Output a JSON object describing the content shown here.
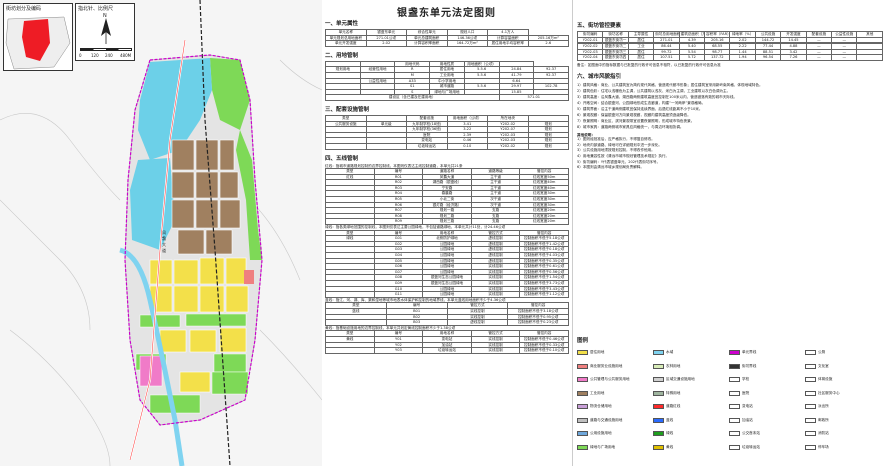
{
  "title": "银盏东单元法定图则",
  "inset": {
    "title": "街坊划分及编码",
    "north_title": "指北针、比例尺",
    "north": "N",
    "scale": [
      "0",
      "120",
      "240",
      "480M"
    ]
  },
  "s1": {
    "title": "一、单元属性",
    "rows": [
      [
        "单元名称",
        "银盏东单元",
        "综合性单元",
        "规划人口",
        "4.1万人"
      ],
      [
        "单元规划总用地面积",
        "271.01公顷",
        "单元总建筑面积",
        "146.36公顷",
        "计算容量面积",
        "205.16万m²"
      ],
      [
        "单元开发强度",
        "2.02",
        "计算容积率面积",
        "164.72万m²",
        "居住用地平均容积率",
        "2.6"
      ]
    ]
  },
  "s2": {
    "title": "二、用地管制",
    "head": [
      "",
      "",
      "用地代码",
      "用地性质",
      "用地面积（公顷）",
      ""
    ],
    "rows": [
      [
        "规划用地",
        "经营性用地",
        "R",
        "居住用地",
        "5.5.6",
        "24.84",
        "92.37"
      ],
      [
        "",
        "",
        "M",
        "工业用地",
        "5.5.6",
        "41.79",
        "92.37"
      ],
      [
        "",
        "公益性用地",
        "A33",
        "中小学用地",
        "",
        "6.64",
        ""
      ],
      [
        "",
        "",
        "S1",
        "城市道路",
        "5.5.6",
        "29.97",
        "102.78"
      ],
      [
        "",
        "",
        "S",
        "绿地与广场用地",
        "",
        "15.85",
        ""
      ]
    ],
    "total": [
      "建设区（含已建及在建用地）",
      "",
      "",
      "",
      "",
      "",
      "",
      "",
      "",
      "571.01"
    ]
  },
  "s3": {
    "title": "三、配套设施管制",
    "head": [
      "类型",
      "",
      "配套设施",
      "用地面积（公顷）",
      "所在地块",
      ""
    ],
    "rows": [
      [
        "公共服务设施",
        "单元级",
        "九年制学校(18班)",
        "3.41",
        "Y202-02",
        "规划"
      ],
      [
        "",
        "",
        "九年制学校(36班)",
        "3.22",
        "Y202-07",
        "规划"
      ],
      [
        "",
        "",
        "医院",
        "2.39",
        "Y202-03",
        "规划"
      ],
      [
        "",
        "",
        "变电站",
        "0.46",
        "Y202-03",
        "规划"
      ],
      [
        "",
        "",
        "垃圾转运站",
        "0.10",
        "Y202-02",
        "规划"
      ]
    ]
  },
  "s4": {
    "title": "四、五线管制",
    "red_note": "红线：指城市道路规划控制的边界控制线，本图则仅表达主线控制道路，本单元共21条",
    "red_head": [
      "类型",
      "编号",
      "道路名称",
      "道路等级",
      "管控内容"
    ],
    "red_rows": [
      [
        "红线",
        "R01",
        "凤翥大道",
        "主干道",
        "红线宽度50m"
      ],
      [
        "",
        "R02",
        "湖西路（银盏段）",
        "主干道",
        "红线宽度40m"
      ],
      [
        "",
        "R03",
        "宁安路",
        "主干道",
        "红线宽度40m"
      ],
      [
        "",
        "R04",
        "春晨路",
        "主干道",
        "红线宽度30m"
      ],
      [
        "",
        "R05",
        "小北二街",
        "次干道",
        "红线宽度30m"
      ],
      [
        "",
        "R06",
        "银灯路（经济路）",
        "次干道",
        "红线宽度30m"
      ],
      [
        "",
        "R07",
        "规划一路",
        "支路",
        "红线宽度20m"
      ],
      [
        "",
        "R08",
        "规划二路",
        "支路",
        "红线宽度20m"
      ],
      [
        "",
        "R09",
        "规划三路",
        "支路",
        "红线宽度20m"
      ]
    ],
    "green_note": "绿线：指各类绿地范围的控制线，本图则仅表达主要公园绿地，不包括道路绿地，本单元共计11处，计24.46公顷",
    "green_head": [
      "类型",
      "编号",
      "用地名称",
      "管控方式",
      "管控内容"
    ],
    "green_rows": [
      [
        "绿线",
        "G01",
        "北侧防护绿地",
        "虚线控制",
        "控制面积不低于5.18公顷"
      ],
      [
        "",
        "G02",
        "公园绿地",
        "虚线控制",
        "控制面积不低于1.42公顷"
      ],
      [
        "",
        "G03",
        "公园绿地",
        "虚线控制",
        "控制面积不低于0.18公顷"
      ],
      [
        "",
        "G04",
        "公园绿地",
        "虚线控制",
        "控制面积不低于4.03公顷"
      ],
      [
        "",
        "G05",
        "公园绿地",
        "虚线控制",
        "控制面积不低于0.35公顷"
      ],
      [
        "",
        "G06",
        "公园绿地",
        "实线控制",
        "控制面积不低于0.61公顷"
      ],
      [
        "",
        "G07",
        "公园绿地",
        "实线控制",
        "控制面积不低于0.56公顷"
      ],
      [
        "",
        "G08",
        "银盏河生态公园绿地",
        "实线控制",
        "控制面积不低于1.54公顷"
      ],
      [
        "",
        "G09",
        "银盏河生态公园绿地",
        "实线控制",
        "控制面积不低于3.73公顷"
      ],
      [
        "",
        "G10",
        "公园绿地",
        "实线控制",
        "控制面积不低于3.43公顷"
      ],
      [
        "",
        "G11",
        "公园绿地",
        "实线控制",
        "控制面积不低于1.12公顷"
      ]
    ],
    "blue_note": "蓝线：指江、河、湖、库、渠和湿地等城市地表水体保护和控制的地域界线，本单元蓝线用地面积不少于4.36公顷",
    "blue_head": [
      "类型",
      "编号",
      "管控方式",
      "管控内容"
    ],
    "blue_rows": [
      [
        "蓝线",
        "B01",
        "实线控制",
        "控制面积不低于3.18公顷"
      ],
      [
        "",
        "B02",
        "实线控制",
        "控制面积不低于0.95公顷"
      ],
      [
        "",
        "B03",
        "虚线控制",
        "控制面积不低于0.23公顷"
      ]
    ],
    "yellow_note": "黄线：指基础设施用地的边界控制线，本单元共划定黄线控制面积不少于1.38公顷",
    "yellow_head": [
      "类型",
      "编号",
      "用地名称",
      "管控方式",
      "管控内容"
    ],
    "yellow_rows": [
      [
        "黄线",
        "Y01",
        "变电站",
        "实线控制",
        "控制面积不低于0.46公顷"
      ],
      [
        "",
        "Y02",
        "加油站",
        "实线控制",
        "控制面积不低于0.33公顷"
      ],
      [
        "",
        "Y03",
        "垃圾转运站",
        "实线控制",
        "控制面积不低于0.10公顷"
      ]
    ]
  },
  "s5": {
    "title": "五、街坊管控要素",
    "head": [
      "街坊编码",
      "街坊名称",
      "主导属性",
      "街坊总用地面积（公顷）",
      "建筑总面积（万m²）",
      "容积率（FAR）",
      "绿地率（%）",
      "公共设施",
      "开发强度",
      "配套设施",
      "公益性设施",
      "其他"
    ],
    "rows": [
      [
        "Y202-01",
        "银盏东街坊一",
        "居住",
        "271.01",
        "4.39",
        "205.16",
        "2.02",
        "144.72",
        "14.45",
        "—",
        "—",
        ""
      ],
      [
        "",
        "",
        "",
        "",
        "",
        "",
        "",
        "",
        "",
        "",
        "",
        ""
      ],
      [
        "Y202-02",
        "银盏东街坊二",
        "工业",
        "86.44",
        "5.40",
        "68.55",
        "2.22",
        "77.44",
        "4.88",
        "—",
        "—",
        ""
      ],
      [
        "Y202-03",
        "银盏东街坊三",
        "居住",
        "99.72",
        "5.54",
        "98.77",
        "1.44",
        "88.51",
        "3.42",
        "—",
        "—",
        ""
      ],
      [
        "Y202-04",
        "银盏东街坊四",
        "居住",
        "107.51",
        "5.72",
        "137.72",
        "1.94",
        "96.54",
        "7.26",
        "—",
        "—",
        ""
      ]
    ],
    "note": "备注：如图面中的指标数据与已批复的行政许可信息不相符，以已批复的行政许可信息为准"
  },
  "s6": {
    "title": "六、城市风貌指引",
    "items": [
      "1）建筑风格：商业、公共建筑宜为简约现代风格，营造现代都市形象；居住建筑宜采用新岭南风格，体现地域特色。",
      "2）建筑色彩：住宅以浅暖色为主调，公共建筑以浅灰、米白为主调，工业建筑以灰白色调为主。",
      "3）建筑高度：沿凤翥大道、湖西路两侧建筑高度宜控制在100米以内，营造错落有致的城市天际线。",
      "4）开敞空间：结合银盏河、公园绿地形成生态廊道，构建“一河两岸”景观格局。",
      "5）建筑界面：沿主干道两侧建筑宜保持连续界面，后退红线距离不小于10米。",
      "6）景观视廊：保留银盏河方向景观视廊，视廊内建筑高度须逐级降低。",
      "7）夜景照明：商业区、滨河景观带宜设置夜景照明，形成城市特色夜景。",
      "8）城市家具：道路两侧城市家具应风格统一，与周边环境相协调。"
    ],
    "extra_title": "其他说明：",
    "extra": [
      "1）图则经批准后，应严格执行，不得擅自修改。",
      "2）地块内部道路、绿地可在详细规划中进一步深化。",
      "3）公共设施用地须按规划控制，不得改作他用。",
      "4）用地兼容性按《清远市城市规划管理技术规定》执行。",
      "5）街坊编码：Y代表银盏单元，202代表街坊序号。",
      "6）本图则由清远市城乡规划局负责解释。"
    ]
  },
  "legend": {
    "title": "图例",
    "items": [
      [
        "居住用地",
        "#f3e04a"
      ],
      [
        "商业服务业设施用地",
        "#ef8080"
      ],
      [
        "公共管理与公共服务用地",
        "#f07bc8"
      ],
      [
        "工业用地",
        "#a08060"
      ],
      [
        "物流仓储用地",
        "#c9a0d8"
      ],
      [
        "道路与交通设施用地",
        "#bfbfbf"
      ],
      [
        "公用设施用地",
        "#6fa8dc"
      ],
      [
        "绿地与广场用地",
        "#7ed957"
      ],
      [
        "水域",
        "#7fd3f0"
      ],
      [
        "农林用地",
        "#d8ecb8"
      ],
      [
        "区域交通设施用地",
        "#d0d0d0"
      ],
      [
        "特殊用地",
        "#9fb59f"
      ],
      [
        "道路红线",
        "#ff2a2a"
      ],
      [
        "蓝线",
        "#2a6bff"
      ],
      [
        "绿线",
        "#1e9e1e"
      ],
      [
        "黄线",
        "#e0c000"
      ],
      [
        "单元界线",
        "#cc00cc"
      ],
      [
        "街坊界线",
        "#333333"
      ],
      [
        "学校",
        "#ffffff"
      ],
      [
        "医院",
        "#ffffff"
      ],
      [
        "变电站",
        "#ffffff"
      ],
      [
        "加油站",
        "#ffffff"
      ],
      [
        "公交首末站",
        "#ffffff"
      ],
      [
        "垃圾转运站",
        "#ffffff"
      ],
      [
        "公厕",
        "#ffffff"
      ],
      [
        "文化室",
        "#ffffff"
      ],
      [
        "体育设施",
        "#ffffff"
      ],
      [
        "社区服务中心",
        "#ffffff"
      ],
      [
        "派出所",
        "#ffffff"
      ],
      [
        "邮政所",
        "#ffffff"
      ],
      [
        "消防站",
        "#ffffff"
      ],
      [
        "停车场",
        "#ffffff"
      ]
    ]
  },
  "map_labels": [
    "凤",
    "翥",
    "大",
    "道"
  ]
}
